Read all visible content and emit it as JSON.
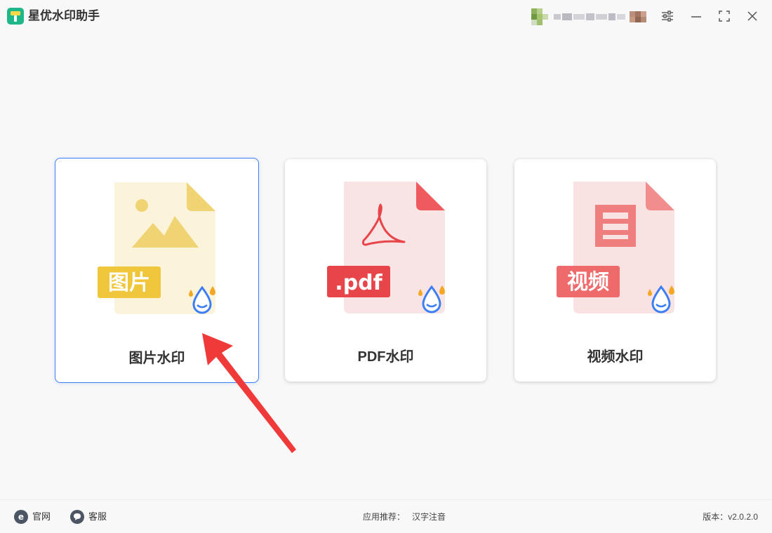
{
  "app": {
    "title": "星优水印助手"
  },
  "cards": [
    {
      "label": "图片水印",
      "badge": "图片",
      "selected": true
    },
    {
      "label": "PDF水印",
      "badge": ".pdf",
      "selected": false
    },
    {
      "label": "视频水印",
      "badge": "视频",
      "selected": false
    }
  ],
  "footer": {
    "website_label": "官网",
    "support_label": "客服",
    "recommend_prefix": "应用推荐：",
    "recommend_app": "汉字注音",
    "version_prefix": "版本：",
    "version": "v2.0.2.0"
  },
  "colors": {
    "image_accent": "#f0c63a",
    "pdf_accent": "#e8454a",
    "video_accent": "#ef6b6b",
    "selected_border": "#3d7ef5",
    "arrow": "#f03a3a"
  }
}
